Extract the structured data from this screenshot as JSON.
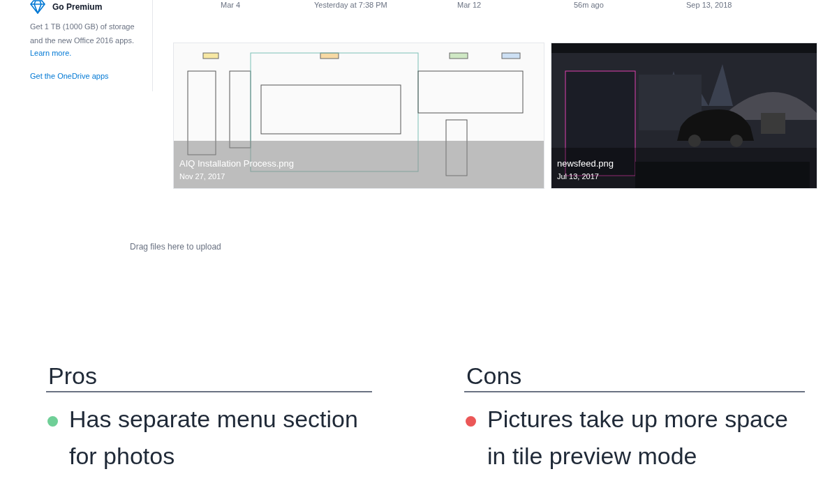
{
  "sidebar": {
    "premium_title": "Go Premium",
    "premium_text": "Get 1 TB (1000 GB) of storage and the new Office 2016 apps.",
    "learn_more": "Learn more.",
    "apps_link": "Get the OneDrive apps"
  },
  "dates": [
    "Mar 4",
    "Yesterday at 7:38 PM",
    "Mar 12",
    "56m ago",
    "Sep 13, 2018"
  ],
  "tiles": [
    {
      "name": "AIQ Installation Process.png",
      "date": "Nov 27, 2017",
      "kind": "diagram"
    },
    {
      "name": "newsfeed.png",
      "date": "Jul 13, 2017",
      "kind": "dark"
    }
  ],
  "drop_hint": "Drag files here to upload",
  "pros": {
    "title": "Pros",
    "items": [
      {
        "text": "Has separate menu section for photos",
        "color": "#6fcf97"
      }
    ]
  },
  "cons": {
    "title": "Cons",
    "items": [
      {
        "text": "Pictures take up more space in tile preview mode",
        "color": "#eb5757"
      }
    ]
  }
}
